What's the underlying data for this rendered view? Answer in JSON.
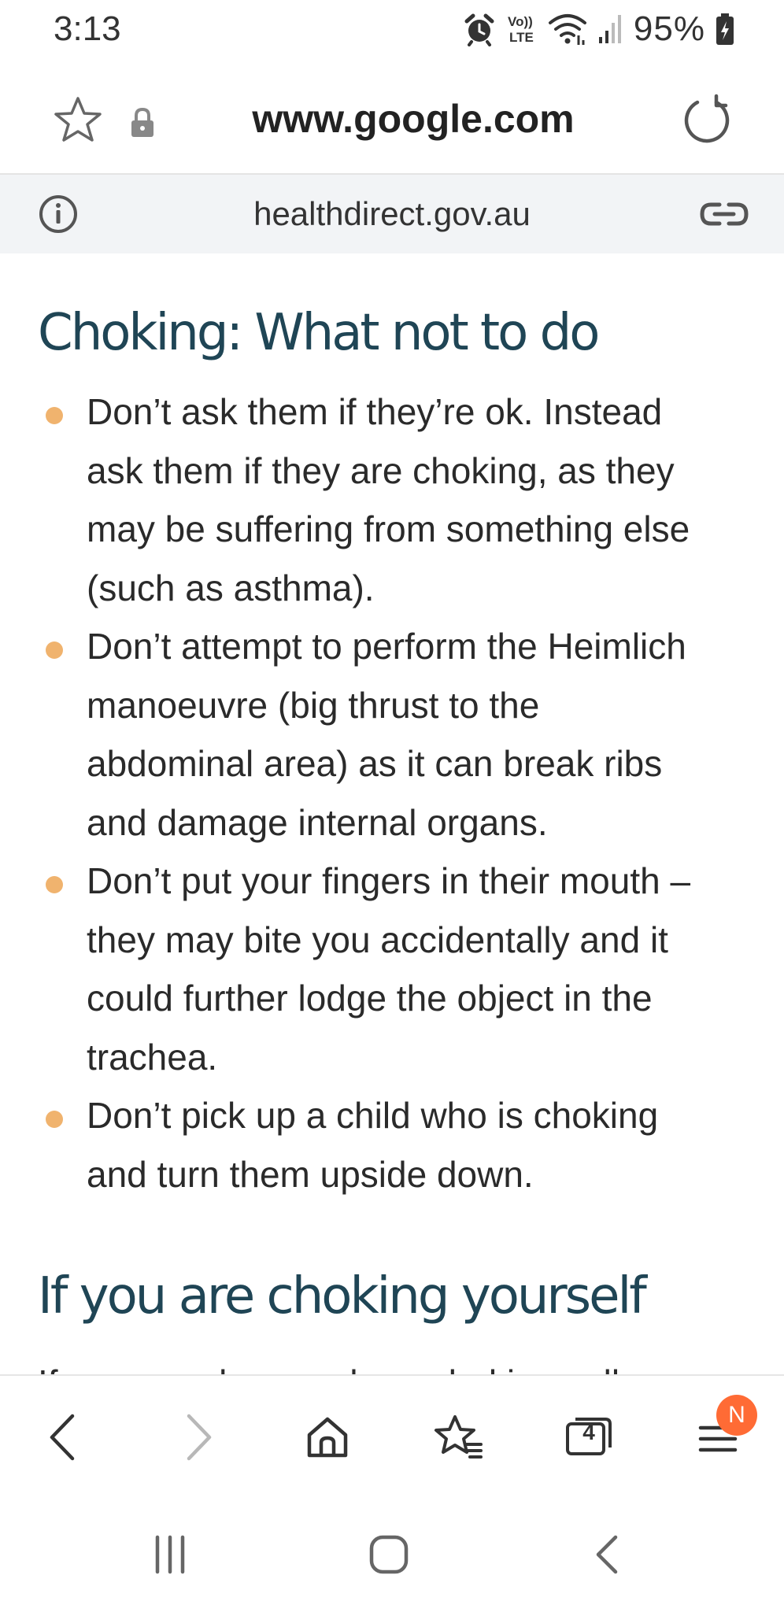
{
  "status_bar": {
    "time": "3:13",
    "battery_text": "95%",
    "icons": [
      "alarm-icon",
      "volte-icon",
      "wifi-icon",
      "signal-icon",
      "battery-charging-icon"
    ]
  },
  "browser": {
    "url": "www.google.com",
    "site": "healthdirect.gov.au",
    "icons": [
      "star-icon",
      "lock-icon",
      "reload-icon",
      "info-icon",
      "link-icon"
    ]
  },
  "article": {
    "heading": "Choking: What not to do",
    "bullets": [
      {
        "lines": [
          "Don’t ask them if they’re ok. Instead",
          "ask them if they are choking, as they",
          "may be suffering from something else",
          "(such as asthma)."
        ]
      },
      {
        "lines": [
          "Don’t attempt to perform the Heimlich",
          "manoeuvre (big thrust to the",
          "abdominal area) as it can break ribs",
          "and damage internal organs."
        ]
      },
      {
        "lines": [
          "Don’t put your fingers in their mouth –",
          "they may bite you accidentally and it",
          "could further lodge the object in the",
          "trachea."
        ]
      },
      {
        "lines": [
          "Don’t pick up a child who is choking",
          "and turn them upside down."
        ]
      }
    ],
    "heading2": "If you are choking yourself",
    "next_text": "If you are alone and are choking call"
  },
  "toolbar": {
    "tabs_count": "4",
    "menu_badge": "N",
    "icons": [
      "back-icon",
      "forward-icon",
      "home-icon",
      "bookmarks-icon",
      "tabs-icon",
      "menu-icon"
    ]
  },
  "colors": {
    "heading": "#1f4555",
    "bullet": "#f0b36e",
    "badge": "#ff6b35",
    "site_bar": "#f2f4f6"
  }
}
